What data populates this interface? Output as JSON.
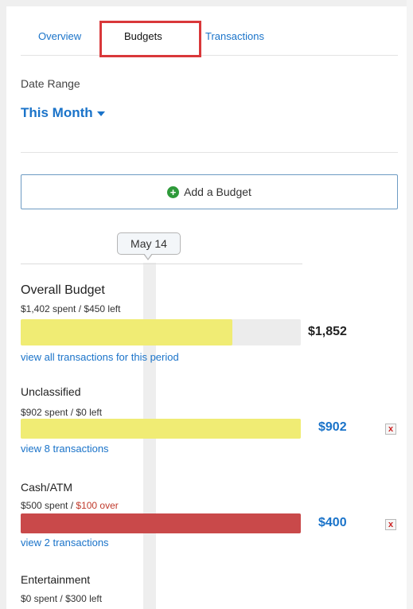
{
  "tabs": [
    {
      "label": "Overview"
    },
    {
      "label": "Budgets"
    },
    {
      "label": "Transactions"
    }
  ],
  "date_range": {
    "label": "Date Range",
    "value": "This Month"
  },
  "add_budget_label": "Add a Budget",
  "timeline_marker": "May 14",
  "overall": {
    "title": "Overall Budget",
    "summary": "$1,402 spent / $450 left",
    "amount": "$1,852",
    "fill_fraction": 0.757,
    "link": "view all transactions for this period"
  },
  "budgets": [
    {
      "name": "Unclassified",
      "spent": "$902 spent /",
      "remaining": "$0 left",
      "over_budget": false,
      "amount": "$902",
      "fill_fraction": 1.0,
      "link": "view 8 transactions"
    },
    {
      "name": "Cash/ATM",
      "spent": "$500 spent /",
      "remaining": "$100 over",
      "over_budget": true,
      "amount": "$400",
      "fill_fraction": 1.0,
      "link": "view 2 transactions"
    },
    {
      "name": "Entertainment",
      "spent": "$0 spent /",
      "remaining": "$300 left",
      "over_budget": false
    }
  ],
  "remove_glyph": "x",
  "colors": {
    "link": "#1a73c9",
    "bar_under": "#f0ec74",
    "bar_over": "#c9494a",
    "over_text": "#c0392b",
    "tab_highlight": "#d9383a",
    "add_icon": "#2e9a3a"
  },
  "icons": [
    "plus-circle-icon",
    "caret-down-icon",
    "remove-x-icon"
  ]
}
